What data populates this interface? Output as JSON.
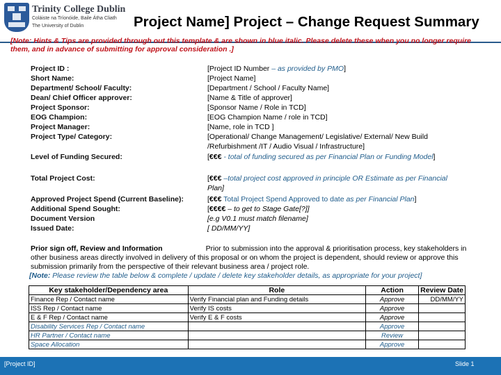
{
  "header": {
    "logo_icon": "trinity-crest-icon",
    "institution_name": "Trinity College Dublin",
    "institution_irish": "Coláiste na Tríonóide, Baile Átha Cliath",
    "institution_sub": "The University of Dublin",
    "title": "Project Name] Project – Change Request Summary"
  },
  "note_red": "[Note: Hints & Tips are provided through out this template & are shown in blue italic. Please delete these when you no longer require them, and in advance of submitting for approval consideration .]",
  "details": [
    {
      "label": "Project ID :",
      "value_plain": "[Project ID Number ",
      "value_hint": "– as provided by PMO",
      "value_end": "]"
    },
    {
      "label": "Short Name:",
      "value_plain": "[Project Name]"
    },
    {
      "label": "Department/ School/ Faculty:",
      "value_plain": "[Department / School / Faculty Name]"
    },
    {
      "label": "Dean/ Chief Officer approver:",
      "value_plain": "[Name & Title of approver]"
    },
    {
      "label": "Project Sponsor:",
      "value_plain": "[Sponsor Name / Role in TCD]"
    },
    {
      "label": "EOG Champion:",
      "value_plain": "[EOG Champion Name / role in TCD]"
    },
    {
      "label": "Project Manager:",
      "value_plain": "[Name, role in TCD ]"
    },
    {
      "label": "Project Type/ Category:",
      "value_plain": "[Operational/ Change Management/ Legislative/ External/ New Build",
      "value_line2": "/Refurbishment /IT / Audio Visual / Infrastructure]"
    },
    {
      "label": "Level of Funding Secured:",
      "value_bold": "€€€",
      "value_hint": " - total of funding secured as per Financial Plan or Funding Model",
      "value_end": "]"
    }
  ],
  "costs": [
    {
      "label": "Total Project Cost:",
      "value_bold": "€€€",
      "value_hint": " –total project cost approved in principle OR Estimate as per Financial",
      "value_line2": "Plan]"
    },
    {
      "label": "Approved Project Spend (Current Baseline):",
      "value_bold": "€€€",
      "value_plain": " Total Project Spend Approved to date ",
      "value_hint": "as per Financial Plan",
      "value_end": "]"
    },
    {
      "label": "Additional Spend Sought:",
      "value_bold": "€€€€",
      "value_hint_dark": " – to get to Stage  Gate[?]]"
    },
    {
      "label": "Document Version",
      "value_hint": "[e.g V0.1 must match filename]"
    },
    {
      "label": "Issued Date:",
      "value_hint": "[ DD/MM/YY]"
    }
  ],
  "prior_signoff": {
    "heading": "Prior sign off, Review and Information",
    "body": "Prior to submission into the approval & prioritisation process, key stakeholders in other business areas directly involved in delivery of this proposal or on whom the project is dependent, should review or approve this submission primarily from the perspective of their relevant business area / project role.",
    "note_label": "[Note:",
    "note_text": " Please review the table below & complete / update / delete key stakeholder details, as appropriate for your project]"
  },
  "stakeholder_table": {
    "headers": [
      "Key stakeholder/Dependency area",
      "Role",
      "Action",
      "Review Date"
    ],
    "rows": [
      {
        "area": "Finance Rep / Contact name",
        "role": "Verify Financial plan and Funding details",
        "action": "Approve",
        "date": "DD/MM/YY",
        "hint": false
      },
      {
        "area": "ISS Rep / Contact  name",
        "role": "Verify IS costs",
        "action": "Approve",
        "date": "",
        "hint": false
      },
      {
        "area": "E & F Rep / Contact name",
        "role": "Verify  E & F costs",
        "action": "Approve",
        "date": "",
        "hint": false
      },
      {
        "area": "Disability Services Rep / Contact name",
        "role": "",
        "action": "Approve",
        "date": "",
        "hint": true
      },
      {
        "area": "HR Partner / Contact name",
        "role": "",
        "action": "Review",
        "date": "",
        "hint": true
      },
      {
        "area": "Space Allocation",
        "role": "",
        "action": "Approve",
        "date": "",
        "hint": true
      }
    ]
  },
  "footer": {
    "left": "[Project ID]",
    "right": "Slide 1"
  },
  "colors": {
    "hint_blue": "#1f5c8b",
    "note_red": "#c0141c",
    "footer_blue": "#1c72b5",
    "rule_blue": "#2a5b8c"
  }
}
